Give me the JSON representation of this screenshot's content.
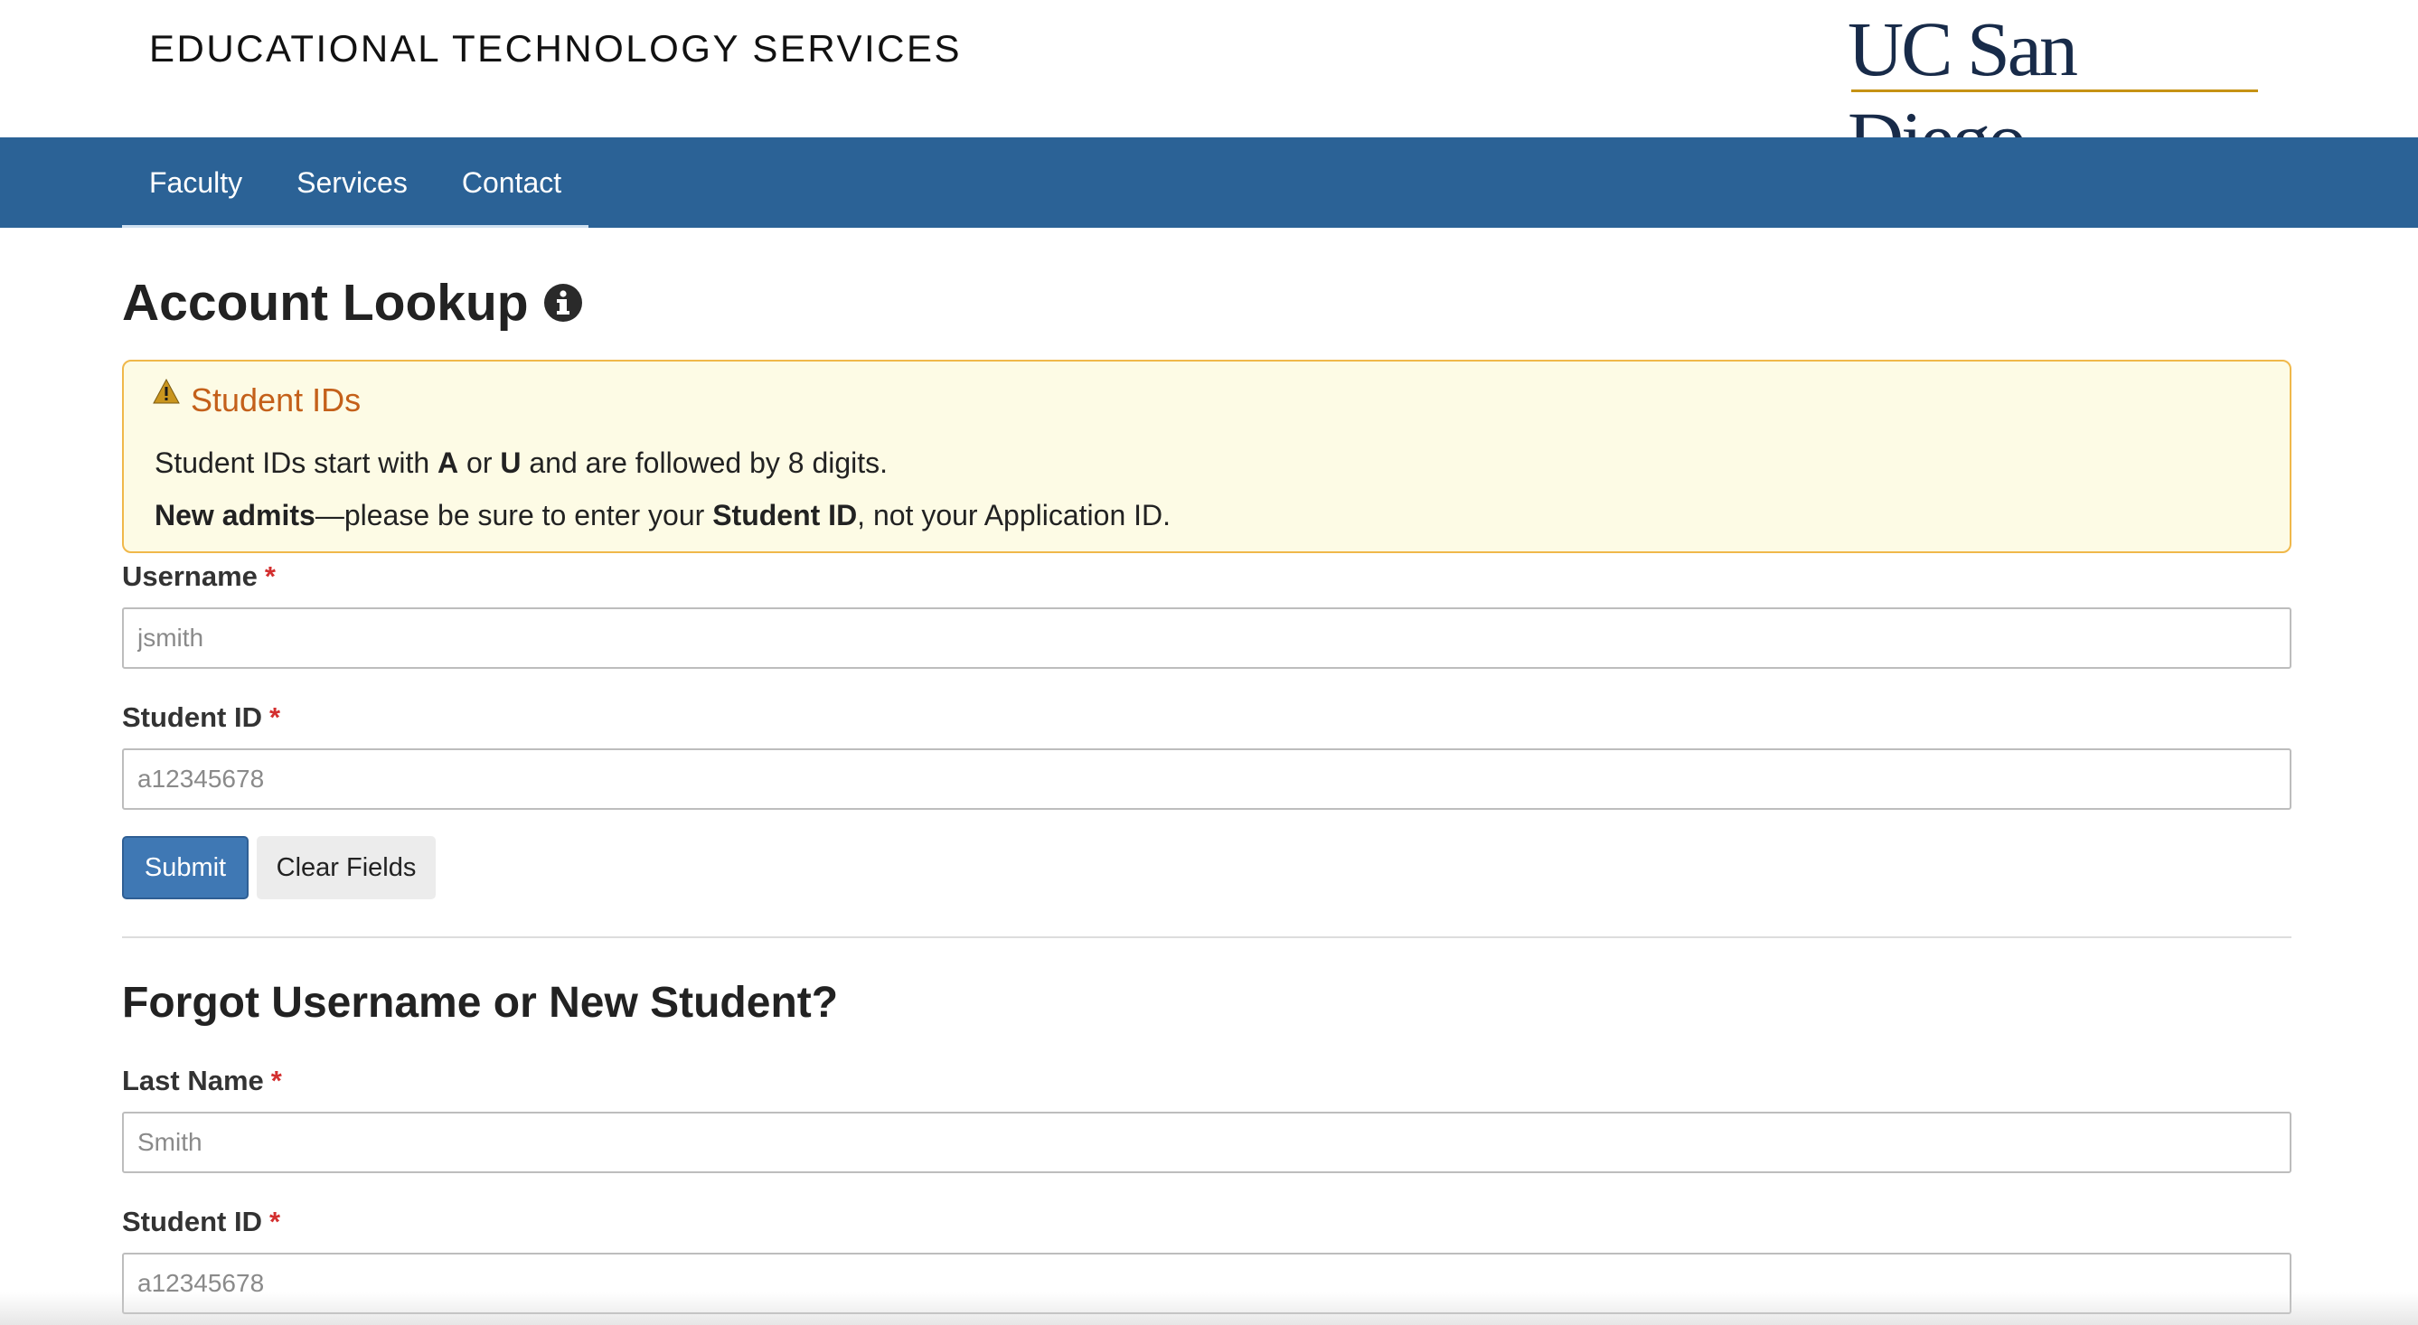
{
  "header": {
    "site_title": "EDUCATIONAL TECHNOLOGY SERVICES",
    "logo_text": "UC San Diego",
    "brand_color": "#182b49",
    "accent_color": "#c69214"
  },
  "nav": {
    "items": [
      {
        "label": "Faculty"
      },
      {
        "label": "Services"
      },
      {
        "label": "Contact"
      }
    ],
    "background_color": "#2b6296"
  },
  "main": {
    "page_title": "Account Lookup",
    "alert": {
      "title": "Student IDs",
      "line1": {
        "t1": "Student IDs start with ",
        "b1": "A",
        "t2": " or ",
        "b2": "U",
        "t3": " and are followed by 8 digits."
      },
      "line2": {
        "b1": "New admits",
        "t1": "—please be sure to enter your ",
        "b2": "Student ID",
        "t2": ", not your Application ID."
      }
    },
    "lookup_form": {
      "username_label": "Username",
      "username_placeholder": "jsmith",
      "student_id_label": "Student ID",
      "student_id_placeholder": "a12345678",
      "required_mark": "*",
      "submit_label": "Submit",
      "clear_label": "Clear Fields"
    },
    "forgot_section": {
      "title": "Forgot Username or New Student?",
      "last_name_label": "Last Name",
      "last_name_placeholder": "Smith",
      "student_id_label": "Student ID",
      "student_id_placeholder": "a12345678",
      "required_mark": "*"
    }
  }
}
